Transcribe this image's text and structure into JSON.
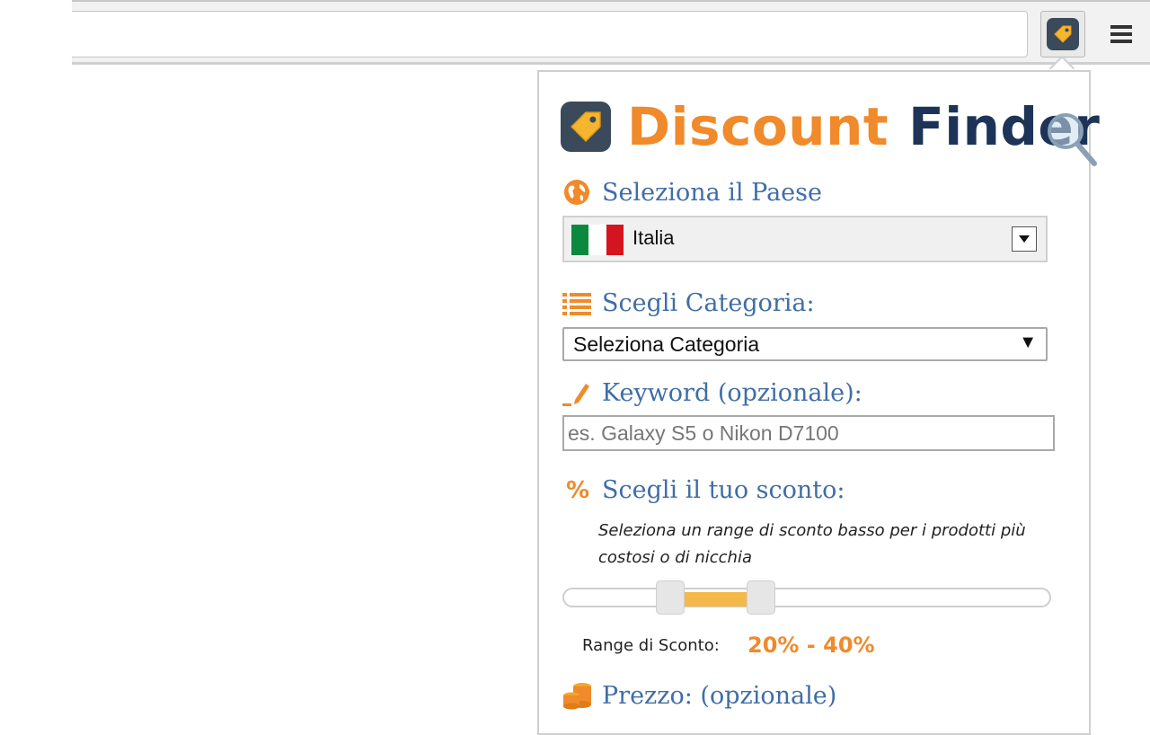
{
  "browser": {
    "extension_icon": "price-tag-icon",
    "menu_icon": "hamburger-menu-icon"
  },
  "popup": {
    "logo": {
      "word1": "Discount",
      "word2": "Finder"
    },
    "country": {
      "label": "Seleziona il Paese",
      "icon": "globe-icon",
      "selected": "Italia",
      "flag_colors": [
        "#0b8a3f",
        "#ffffff",
        "#d4141e"
      ]
    },
    "category": {
      "label": "Scegli Categoria:",
      "icon": "list-icon",
      "selected": "Seleziona Categoria"
    },
    "keyword": {
      "label": "Keyword (opzionale):",
      "icon": "pencil-icon",
      "placeholder": "es. Galaxy S5 o Nikon D7100"
    },
    "discount": {
      "label": "Scegli il tuo sconto:",
      "icon": "percent-icon",
      "hint": "Seleziona un range di sconto basso per i prodotti più costosi o di nicchia",
      "range_label": "Range di Sconto:",
      "range_value": "20% - 40%",
      "min_percent": 20,
      "max_percent": 40
    },
    "price": {
      "label": "Prezzo: (opzionale)",
      "icon": "coins-icon"
    }
  },
  "colors": {
    "accent": "#f08a2a",
    "brand_dark": "#1d3458",
    "label_blue": "#3f6ea6",
    "slider_fill": "#f5b84a"
  }
}
